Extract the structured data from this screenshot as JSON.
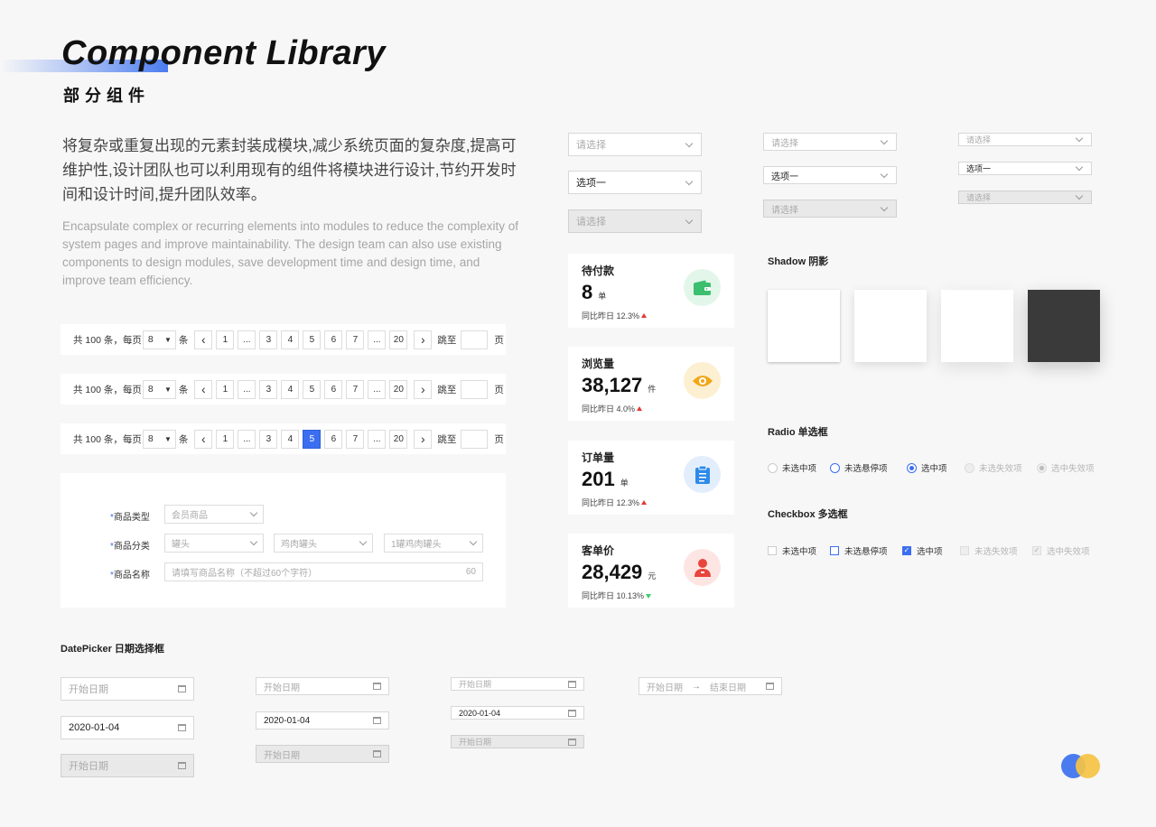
{
  "header": {
    "title": "Component Library",
    "subtitle": "部分组件"
  },
  "intro": {
    "cn": "将复杂或重复出现的元素封装成模块,减少系统页面的复杂度,提高可维护性,设计团队也可以利用现有的组件将模块进行设计,节约开发时间和设计时间,提升团队效率。",
    "en": "Encapsulate complex or recurring elements into modules to reduce the complexity of system pages and improve maintainability. The design team can also use existing components to design modules, save development time and design time, and improve team efficiency."
  },
  "pagination": {
    "total_label": "共 100 条，每页",
    "page_size": "8",
    "per_unit": "条",
    "prev": "‹",
    "next": "›",
    "pages": [
      "1",
      "...",
      "3",
      "4",
      "5",
      "6",
      "7",
      "...",
      "20"
    ],
    "jump_label": "跳至",
    "page_unit": "页",
    "active_page_row3": "5"
  },
  "form": {
    "product_type": {
      "label": "商品类型",
      "placeholder": "会员商品"
    },
    "product_category": {
      "label": "商品分类",
      "options": [
        "罐头",
        "鸡肉罐头",
        "1罐鸡肉罐头"
      ]
    },
    "product_name": {
      "label": "商品名称",
      "placeholder": "请填写商品名称（不超过60个字符）",
      "max": "60"
    }
  },
  "selects": {
    "placeholder": "请选择",
    "option_one": "选项一"
  },
  "stats": [
    {
      "label": "待付款",
      "value": "8",
      "unit": "单",
      "compare": "同比昨日 12.3%",
      "trend": "up",
      "icon": "wallet-icon",
      "icon_bg": "#e3f6ea",
      "icon_color": "#3cbf6e"
    },
    {
      "label": "浏览量",
      "value": "38,127",
      "unit": "件",
      "compare": "同比昨日 4.0%",
      "trend": "up",
      "icon": "eye-icon",
      "icon_bg": "#fdf0d2",
      "icon_color": "#f2a718"
    },
    {
      "label": "订单量",
      "value": "201",
      "unit": "单",
      "compare": "同比昨日 12.3%",
      "trend": "up",
      "icon": "clipboard-icon",
      "icon_bg": "#e2eefc",
      "icon_color": "#2e8ae8"
    },
    {
      "label": "客单价",
      "value": "28,429",
      "unit": "元",
      "compare": "同比昨日 10.13%",
      "trend": "down",
      "icon": "user-icon",
      "icon_bg": "#fde5e3",
      "icon_color": "#e8453c"
    }
  ],
  "shadow": {
    "title": "Shadow 阴影"
  },
  "radio": {
    "title": "Radio 单选框",
    "options": [
      "未选中项",
      "未选悬停项",
      "选中项",
      "未选失效项",
      "选中失效项"
    ]
  },
  "checkbox": {
    "title": "Checkbox 多选框",
    "options": [
      "未选中项",
      "未选悬停项",
      "选中项",
      "未选失效项",
      "选中失效项"
    ]
  },
  "datepicker": {
    "title": "DatePicker 日期选择框",
    "start_placeholder": "开始日期",
    "end_placeholder": "结束日期",
    "value": "2020-01-04",
    "range_arrow": "→"
  },
  "colors": {
    "accent": "#3b6ef0",
    "logo_blue": "#4a7cf0",
    "logo_yellow": "#f5c344"
  }
}
